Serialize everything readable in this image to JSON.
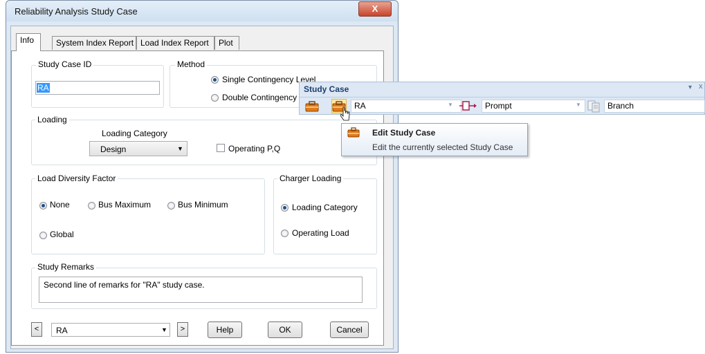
{
  "dialog": {
    "title": "Reliability Analysis Study Case",
    "close_label": "X",
    "tabs": [
      "Info",
      "System Index Report",
      "Load Index Report",
      "Plot"
    ],
    "study_case_id": {
      "label": "Study Case ID",
      "value": "RA"
    },
    "method": {
      "label": "Method",
      "options": [
        "Single Contingency Level",
        "Double Contingency"
      ],
      "selected": "Single Contingency Level"
    },
    "loading": {
      "label": "Loading",
      "category_label": "Loading Category",
      "category_value": "Design",
      "operating_pq_label": "Operating P,Q",
      "operating_pq_checked": false
    },
    "load_diversity": {
      "label": "Load Diversity Factor",
      "options": [
        "None",
        "Bus Maximum",
        "Bus Minimum",
        "Global"
      ],
      "selected": "None"
    },
    "charger_loading": {
      "label": "Charger Loading",
      "options": [
        "Loading Category",
        "Operating Load"
      ],
      "selected": "Loading Category"
    },
    "remarks": {
      "label": "Study Remarks",
      "value": "Second line of remarks for \"RA\" study case."
    },
    "footer": {
      "prev_label": "<",
      "next_label": ">",
      "case_value": "RA",
      "help_label": "Help",
      "ok_label": "OK",
      "cancel_label": "Cancel"
    }
  },
  "toolbar": {
    "title": "Study Case",
    "study_case_value": "RA",
    "output_value": "Prompt",
    "view_value": "Branch",
    "pin_label": "▾",
    "close_label": "x"
  },
  "tooltip": {
    "title": "Edit Study Case",
    "description": "Edit the currently selected Study Case"
  },
  "colors": {
    "accent": "#3399ff",
    "toolbar_title": "#1e3f6e",
    "icon_orange": "#e07b18"
  }
}
